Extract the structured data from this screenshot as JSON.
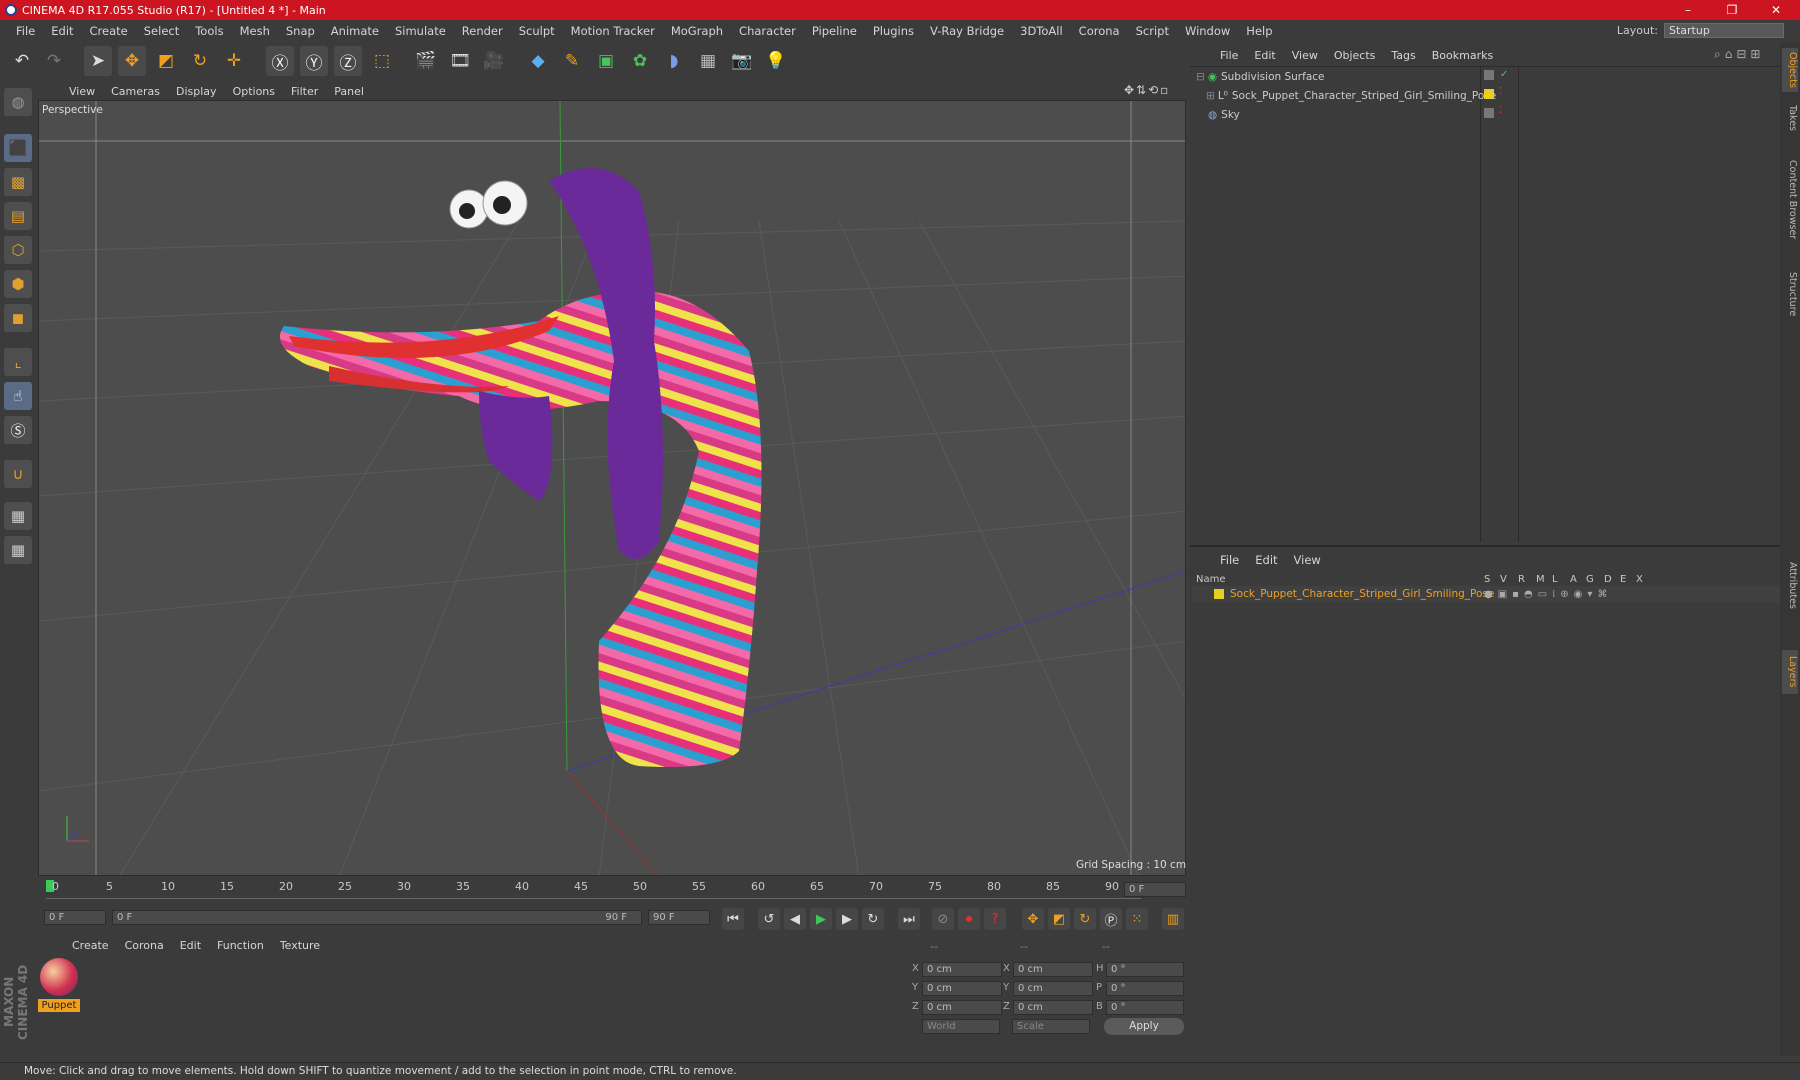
{
  "window": {
    "title": "CINEMA 4D R17.055 Studio (R17) - [Untitled 4 *] - Main",
    "controls": [
      "–",
      "❐",
      "✕"
    ]
  },
  "menubar": [
    "File",
    "Edit",
    "Create",
    "Select",
    "Tools",
    "Mesh",
    "Snap",
    "Animate",
    "Simulate",
    "Render",
    "Sculpt",
    "Motion Tracker",
    "MoGraph",
    "Character",
    "Pipeline",
    "Plugins",
    "V-Ray Bridge",
    "3DToAll",
    "Corona",
    "Script",
    "Window",
    "Help"
  ],
  "layout": {
    "label": "Layout:",
    "value": "Startup"
  },
  "viewport": {
    "menu": [
      "View",
      "Cameras",
      "Display",
      "Options",
      "Filter",
      "Panel"
    ],
    "label": "Perspective",
    "grid_spacing": "Grid Spacing : 10 cm"
  },
  "timeline": {
    "ticks": [
      "0",
      "5",
      "10",
      "15",
      "20",
      "25",
      "30",
      "35",
      "40",
      "45",
      "50",
      "55",
      "60",
      "65",
      "70",
      "75",
      "80",
      "85",
      "90"
    ],
    "frame_field": "0 F",
    "start": "0 F",
    "slider_left": "0 F",
    "slider_right": "90 F",
    "end": "90 F"
  },
  "material": {
    "menu": [
      "Create",
      "Corona",
      "Edit",
      "Function",
      "Texture"
    ],
    "name": "Puppet"
  },
  "coords": {
    "headers": [
      "--",
      "--",
      "--"
    ],
    "rows": [
      [
        "X",
        "0 cm",
        "X",
        "0 cm",
        "H",
        "0 °"
      ],
      [
        "Y",
        "0 cm",
        "Y",
        "0 cm",
        "P",
        "0 °"
      ],
      [
        "Z",
        "0 cm",
        "Z",
        "0 cm",
        "B",
        "0 °"
      ]
    ],
    "world": "World",
    "scale": "Scale",
    "apply": "Apply"
  },
  "objects": {
    "menu": [
      "File",
      "Edit",
      "View",
      "Objects",
      "Tags",
      "Bookmarks"
    ],
    "items": [
      "Subdivision Surface",
      "Sock_Puppet_Character_Striped_Girl_Smiling_Pose",
      "Sky"
    ]
  },
  "layers": {
    "menu": [
      "File",
      "Edit",
      "View"
    ],
    "name_header": "Name",
    "cols": [
      "S",
      "V",
      "R",
      "M",
      "L",
      "A",
      "G",
      "D",
      "E",
      "X"
    ],
    "item": "Sock_Puppet_Character_Striped_Girl_Smiling_Pose"
  },
  "sidetabs": [
    "Objects",
    "Takes",
    "Content Browser",
    "Structure",
    "Attributes",
    "Layers"
  ],
  "brand": "MAXON CINEMA 4D",
  "status": "Move: Click and drag to move elements. Hold down SHIFT to quantize movement / add to the selection in point mode, CTRL to remove."
}
